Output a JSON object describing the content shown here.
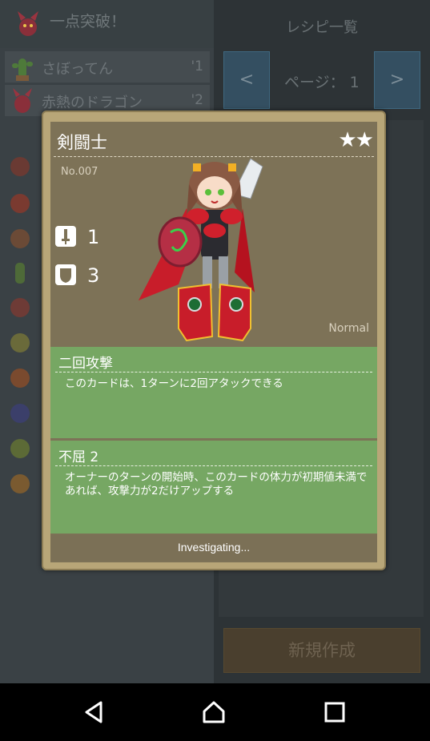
{
  "left_header": {
    "title": "一点突破！",
    "icon": "red-dragon-icon"
  },
  "list": [
    {
      "name": "さぼってん",
      "num": "'1",
      "icon": "cactus-monster-icon"
    },
    {
      "name": "赤熱のドラゴン",
      "num": "'2",
      "icon": "red-dragon-icon"
    }
  ],
  "right_header": {
    "title": "レシピ一覧"
  },
  "pager": {
    "prev": "<",
    "next": ">",
    "page_label": "ページ：  1"
  },
  "new_button": {
    "label": "新規作成"
  },
  "card": {
    "name": "剣闘士",
    "stars": "★★",
    "number": "No.007",
    "rarity": "Normal",
    "attack": "1",
    "defense": "3",
    "skills": [
      {
        "name": "二回攻撃",
        "description": "このカードは、1ターンに2回アタックできる"
      },
      {
        "name": "不屈 2",
        "description": "オーナーのターンの開始時、このカードの体力が初期値未満であれば、攻撃力が2だけアップする"
      }
    ],
    "status": "Investigating..."
  },
  "navbar": {
    "back": "back-icon",
    "home": "home-icon",
    "recents": "recents-icon"
  }
}
